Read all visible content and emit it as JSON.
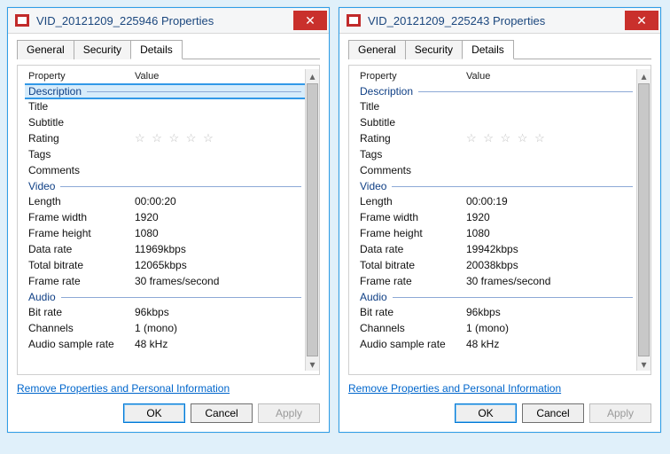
{
  "windows": [
    {
      "title": "VID_20121209_225946 Properties",
      "closeGlyph": "✕",
      "tabs": [
        "General",
        "Security",
        "Details"
      ],
      "activeTab": 2,
      "selectedSection": 0,
      "columns": {
        "prop": "Property",
        "val": "Value"
      },
      "sections": [
        {
          "title": "Description",
          "rows": [
            {
              "label": "Title",
              "value": ""
            },
            {
              "label": "Subtitle",
              "value": ""
            },
            {
              "label": "Rating",
              "value": "",
              "stars": true
            },
            {
              "label": "Tags",
              "value": ""
            },
            {
              "label": "Comments",
              "value": ""
            }
          ]
        },
        {
          "title": "Video",
          "rows": [
            {
              "label": "Length",
              "value": "00:00:20"
            },
            {
              "label": "Frame width",
              "value": "1920"
            },
            {
              "label": "Frame height",
              "value": "1080"
            },
            {
              "label": "Data rate",
              "value": "11969kbps"
            },
            {
              "label": "Total bitrate",
              "value": "12065kbps"
            },
            {
              "label": "Frame rate",
              "value": "30 frames/second"
            }
          ]
        },
        {
          "title": "Audio",
          "rows": [
            {
              "label": "Bit rate",
              "value": "96kbps"
            },
            {
              "label": "Channels",
              "value": "1 (mono)"
            },
            {
              "label": "Audio sample rate",
              "value": "48 kHz"
            }
          ]
        }
      ],
      "removeLink": "Remove Properties and Personal Information",
      "buttons": {
        "ok": "OK",
        "cancel": "Cancel",
        "apply": "Apply"
      }
    },
    {
      "title": "VID_20121209_225243 Properties",
      "closeGlyph": "✕",
      "tabs": [
        "General",
        "Security",
        "Details"
      ],
      "activeTab": 2,
      "selectedSection": -1,
      "columns": {
        "prop": "Property",
        "val": "Value"
      },
      "sections": [
        {
          "title": "Description",
          "rows": [
            {
              "label": "Title",
              "value": ""
            },
            {
              "label": "Subtitle",
              "value": ""
            },
            {
              "label": "Rating",
              "value": "",
              "stars": true
            },
            {
              "label": "Tags",
              "value": ""
            },
            {
              "label": "Comments",
              "value": ""
            }
          ]
        },
        {
          "title": "Video",
          "rows": [
            {
              "label": "Length",
              "value": "00:00:19"
            },
            {
              "label": "Frame width",
              "value": "1920"
            },
            {
              "label": "Frame height",
              "value": "1080"
            },
            {
              "label": "Data rate",
              "value": "19942kbps"
            },
            {
              "label": "Total bitrate",
              "value": "20038kbps"
            },
            {
              "label": "Frame rate",
              "value": "30 frames/second"
            }
          ]
        },
        {
          "title": "Audio",
          "rows": [
            {
              "label": "Bit rate",
              "value": "96kbps"
            },
            {
              "label": "Channels",
              "value": "1 (mono)"
            },
            {
              "label": "Audio sample rate",
              "value": "48 kHz"
            }
          ]
        }
      ],
      "removeLink": "Remove Properties and Personal Information",
      "buttons": {
        "ok": "OK",
        "cancel": "Cancel",
        "apply": "Apply"
      }
    }
  ],
  "scroll": {
    "up": "▴",
    "down": "▾"
  }
}
